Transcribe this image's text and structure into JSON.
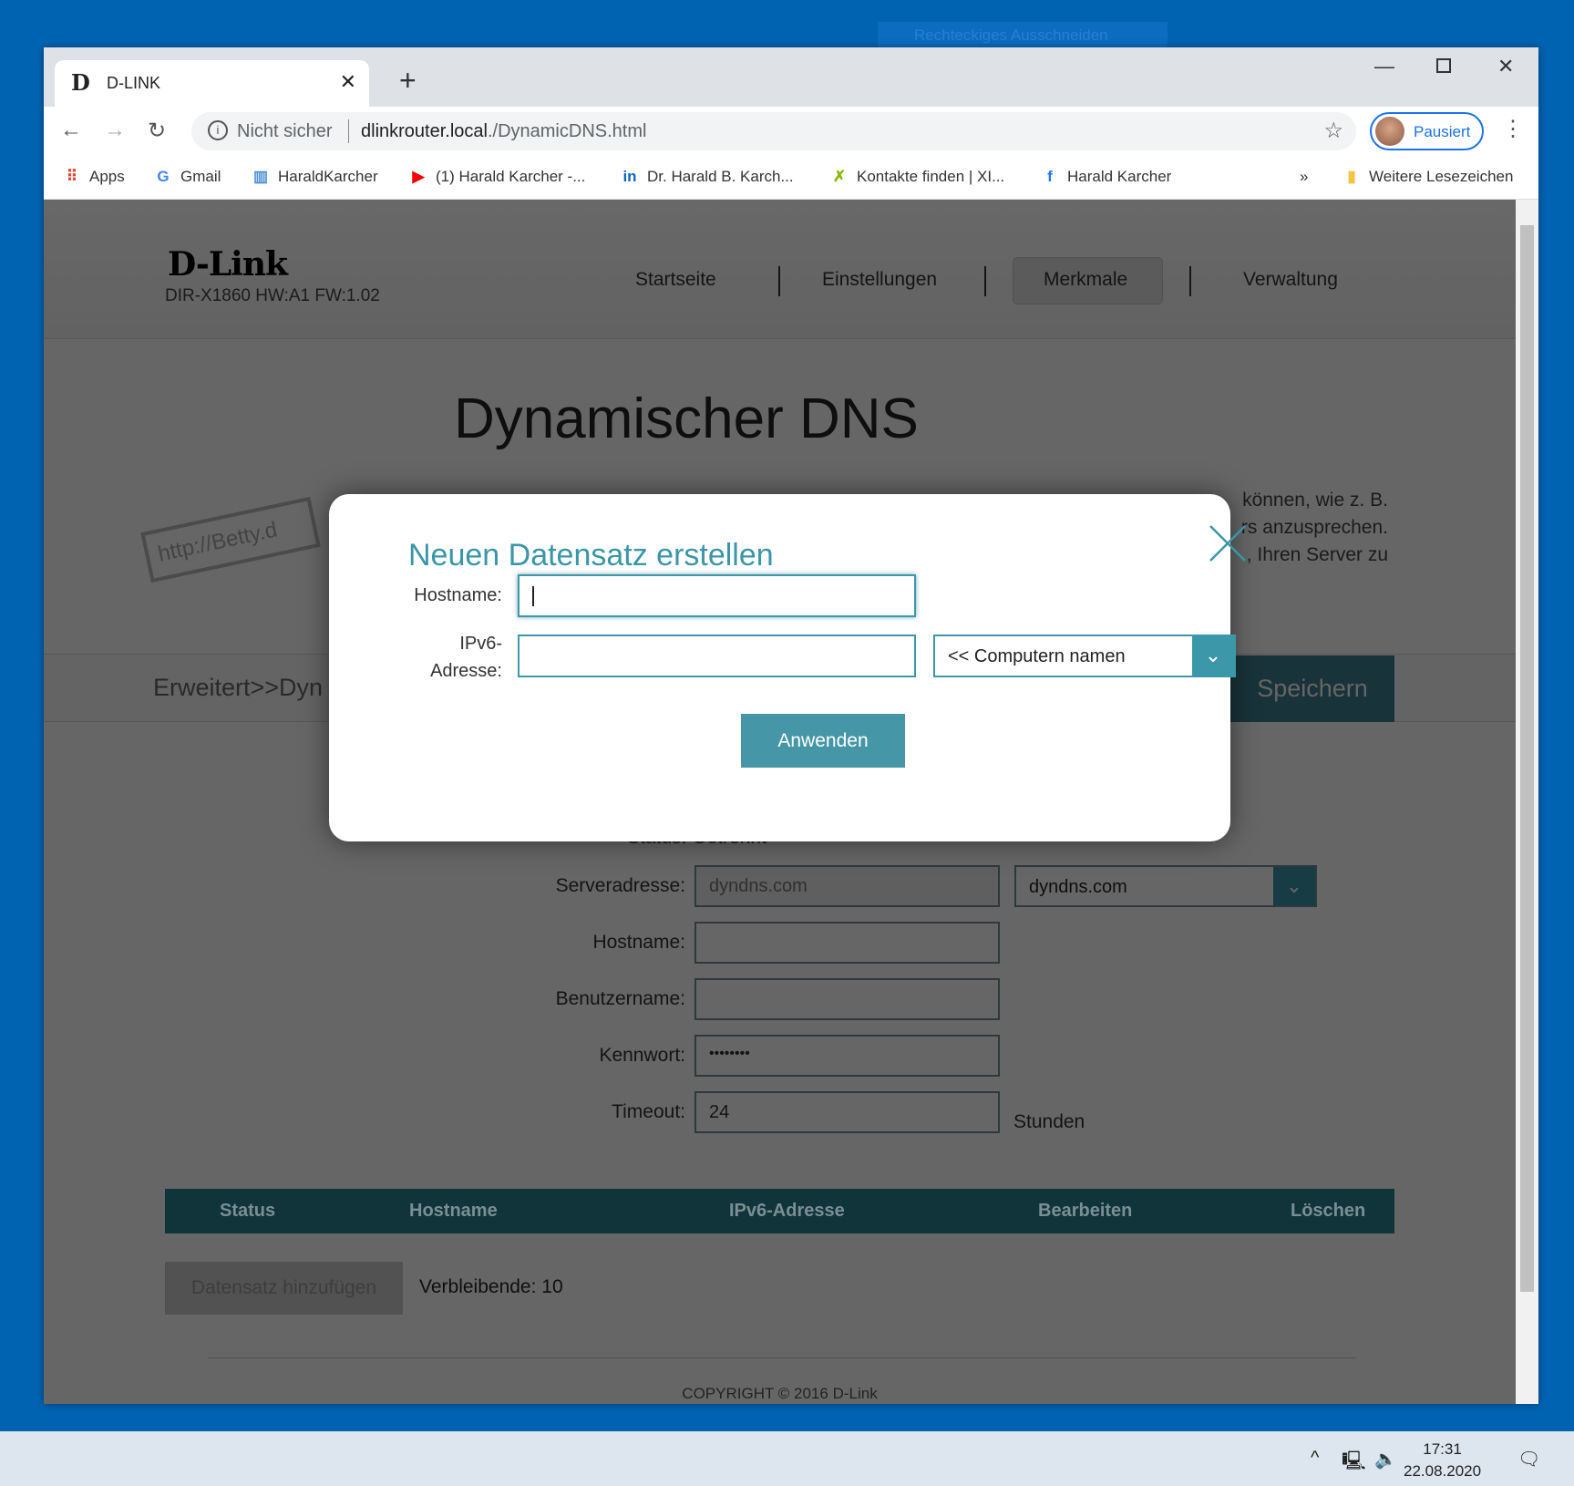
{
  "snip_tool": "Rechteckiges Ausschneiden",
  "browser": {
    "tab_title": "D-LINK",
    "tab_favicon": "D",
    "security_label": "Nicht sicher",
    "url_host": "dlinkrouter.local",
    "url_path": "./DynamicDNS.html",
    "profile_label": "Pausiert",
    "bookmarks": [
      {
        "icon": "apps-icon",
        "label": "Apps"
      },
      {
        "icon": "google-icon",
        "label": "Gmail"
      },
      {
        "icon": "page-icon",
        "label": "HaraldKarcher"
      },
      {
        "icon": "youtube-icon",
        "label": "(1) Harald Karcher -..."
      },
      {
        "icon": "linkedin-icon",
        "label": "Dr. Harald B. Karch..."
      },
      {
        "icon": "xing-icon",
        "label": "Kontakte finden | XI..."
      },
      {
        "icon": "facebook-icon",
        "label": "Harald Karcher"
      }
    ],
    "more_bookmarks": "»",
    "other_bookmarks": "Weitere Lesezeichen"
  },
  "page": {
    "logo": "D-Link",
    "model": "DIR-X1860 HW:A1 FW:1.02",
    "nav": [
      "Startseite",
      "Einstellungen",
      "Merkmale",
      "Verwaltung"
    ],
    "title": "Dynamischer DNS",
    "desc_fragments": [
      "können, wie z. B.",
      "rs anzusprechen.",
      ", Ihren Server zu"
    ],
    "illustration_text": "http://Betty.d",
    "breadcrumb": "Erweitert>>Dyn",
    "save": "Speichern",
    "status": "Status: Getrennt",
    "form": {
      "server_label": "Serveradresse:",
      "server_value": "dyndns.com",
      "server_select": "dyndns.com",
      "host_label": "Hostname:",
      "host_value": "",
      "user_label": "Benutzername:",
      "user_value": "",
      "pass_label": "Kennwort:",
      "pass_value": "••••••••",
      "timeout_label": "Timeout:",
      "timeout_value": "24",
      "timeout_unit": "Stunden"
    },
    "table_headers": [
      "Status",
      "Hostname",
      "IPv6-Adresse",
      "Bearbeiten",
      "Löschen"
    ],
    "add_record": "Datensatz hinzufügen",
    "remaining": "Verbleibende: 10",
    "copyright": "COPYRIGHT © 2016 D-Link"
  },
  "modal": {
    "title": "Neuen Datensatz erstellen",
    "hostname_label": "Hostname:",
    "hostname_value": "",
    "ipv6_label_1": "IPv6-",
    "ipv6_label_2": "Adresse:",
    "ipv6_value": "",
    "computer_select": "<< Computern namen",
    "apply": "Anwenden"
  },
  "taskbar": {
    "time": "17:31",
    "date": "22.08.2020"
  }
}
